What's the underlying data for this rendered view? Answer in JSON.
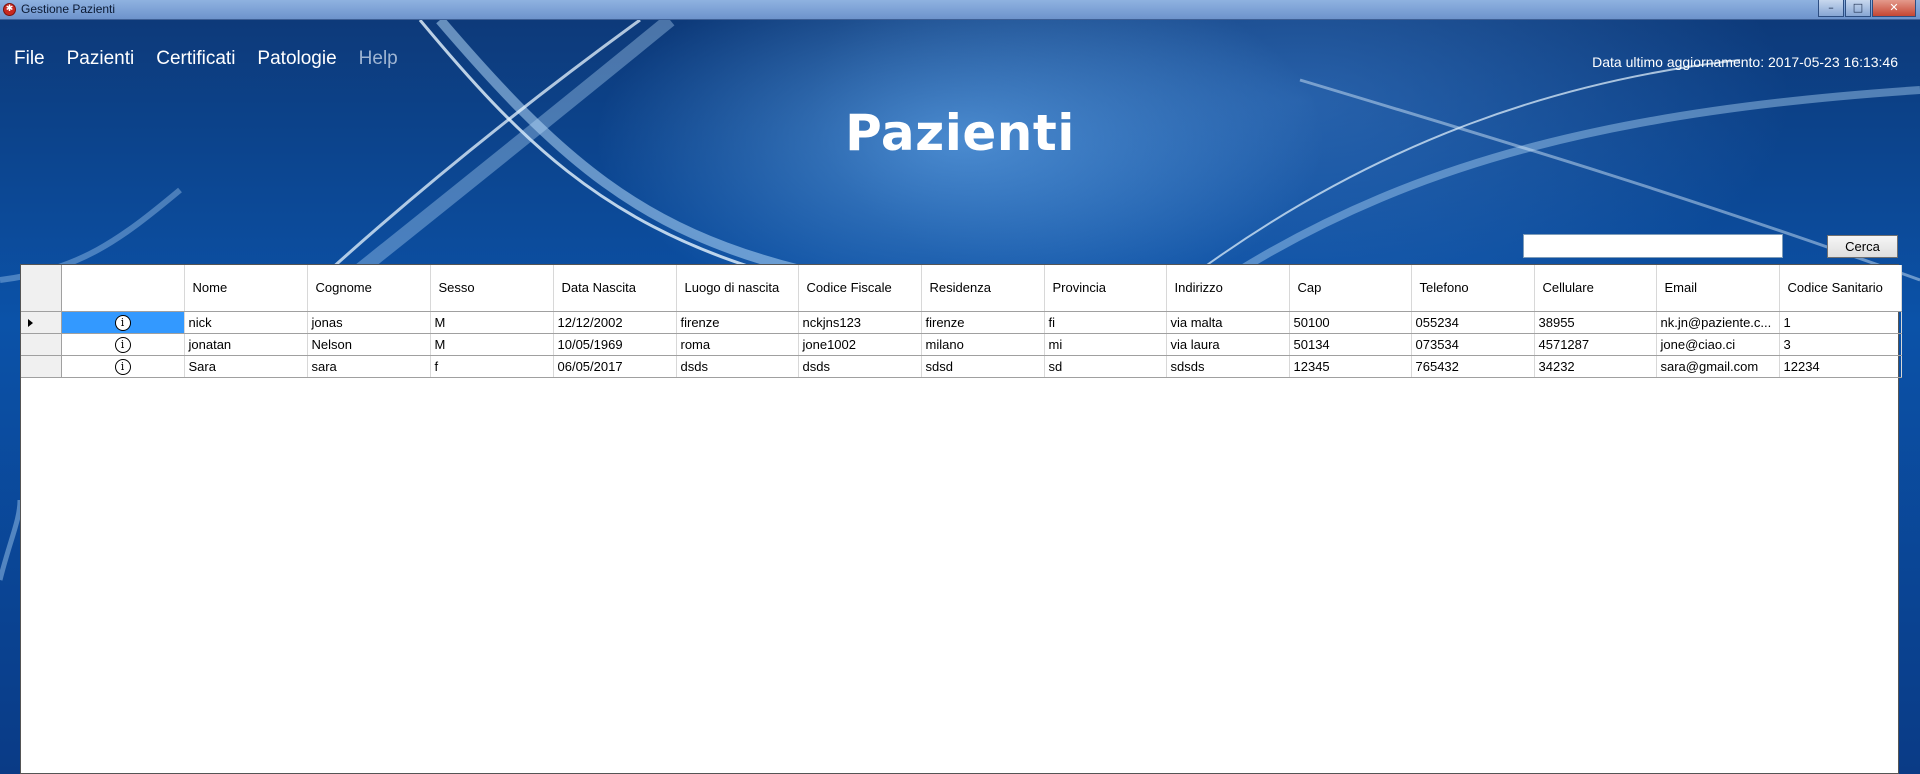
{
  "window": {
    "title": "Gestione Pazienti",
    "controls": {
      "minimize": "–",
      "maximize": "□",
      "close": "✕"
    }
  },
  "menu": {
    "items": [
      {
        "label": "File",
        "enabled": true
      },
      {
        "label": "Pazienti",
        "enabled": true
      },
      {
        "label": "Certificati",
        "enabled": true
      },
      {
        "label": "Patologie",
        "enabled": true
      },
      {
        "label": "Help",
        "enabled": false
      }
    ]
  },
  "header": {
    "update_info": "Data ultimo aggiornamento: 2017-05-23 16:13:46",
    "page_title": "Pazienti"
  },
  "search": {
    "value": "",
    "button_label": "Cerca"
  },
  "table": {
    "columns": [
      "",
      "Nome",
      "Cognome",
      "Sesso",
      "Data Nascita",
      "Luogo di nascita",
      "Codice Fiscale",
      "Residenza",
      "Provincia",
      "Indirizzo",
      "Cap",
      "Telefono",
      "Cellulare",
      "Email",
      "Codice Sanitario"
    ],
    "info_icon_glyph": "i",
    "selected_row": 0,
    "rows": [
      [
        "nick",
        "jonas",
        "M",
        "12/12/2002",
        "firenze",
        "nckjns123",
        "firenze",
        "fi",
        "via malta",
        "50100",
        "055234",
        "38955",
        "nk.jn@paziente.c...",
        "1"
      ],
      [
        "jonatan",
        "Nelson",
        "M",
        "10/05/1969",
        "roma",
        "jone1002",
        "milano",
        "mi",
        "via laura",
        "50134",
        "073534",
        "4571287",
        "jone@ciao.ci",
        "3"
      ],
      [
        "Sara",
        "sara",
        "f",
        "06/05/2017",
        "dsds",
        "dsds",
        "sdsd",
        "sd",
        "sdsds",
        "12345",
        "765432",
        "34232",
        "sara@gmail.com",
        "12234"
      ]
    ]
  },
  "colors": {
    "banner": "#0b52a8",
    "selection": "#3399ff",
    "disabled_menu": "#9fb5d3"
  }
}
